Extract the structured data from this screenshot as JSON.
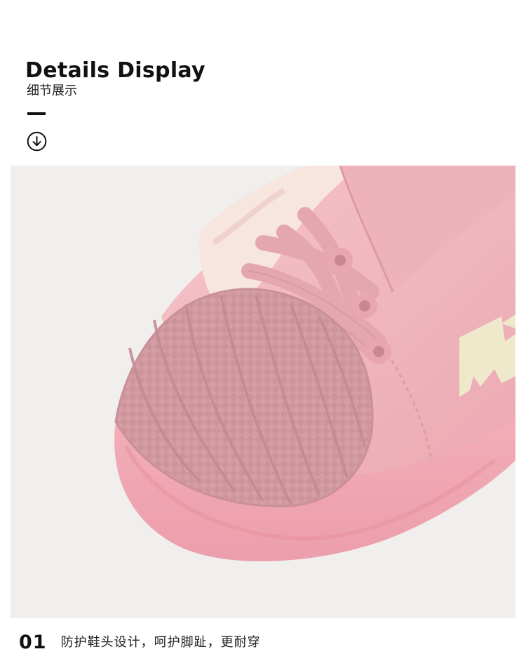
{
  "header": {
    "title": "Details Display",
    "subtitle": "细节展示",
    "scroll_icon": "arrow-down-circle-icon"
  },
  "product_image": {
    "subject": "pink-shell-toe-sneaker-photo",
    "colors": {
      "background": "#f1efee",
      "upper": "#efb5bd",
      "shell": "#d8a1a8",
      "sole": "#f2aab5",
      "lace": "#e6aab4",
      "fur": "#f8e7e2",
      "logo": "#eee9cb"
    }
  },
  "feature": {
    "number": "01",
    "text": "防护鞋头设计，呵护脚趾，更耐穿"
  }
}
